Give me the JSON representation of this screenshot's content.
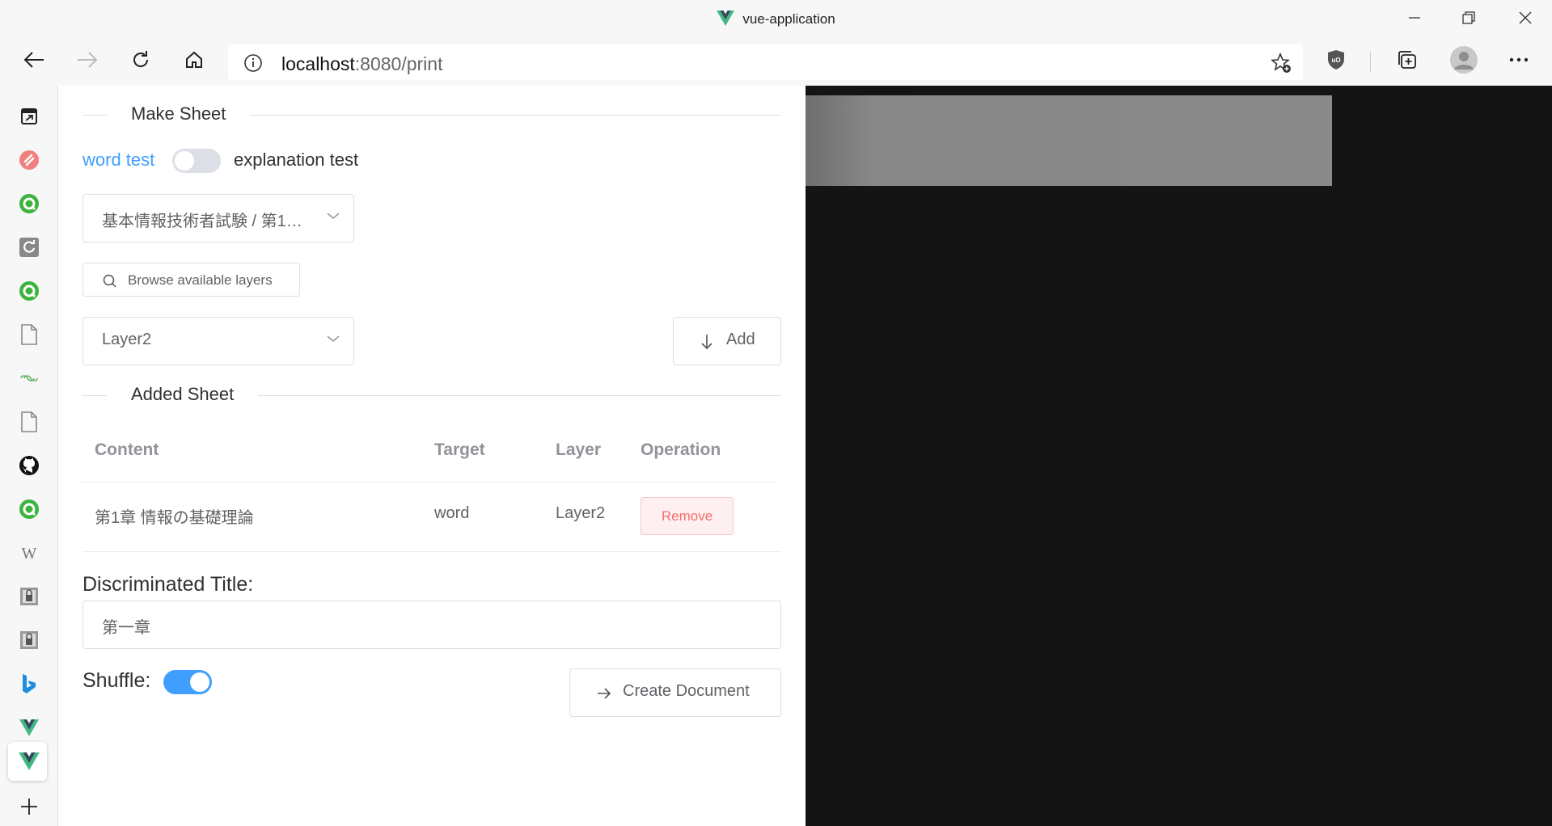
{
  "window": {
    "title": "vue-application"
  },
  "browser": {
    "url_host": "localhost",
    "url_rest": ":8080/print"
  },
  "sidebar": {
    "icons": [
      "tab-actions-icon",
      "scribe-icon",
      "shield-green-icon",
      "refresh-page-icon",
      "shield-green-icon",
      "document-icon",
      "link-icon",
      "document-icon",
      "github-icon",
      "shield-green-icon",
      "wikipedia-icon",
      "lock-page-icon",
      "lock-page-icon",
      "bing-icon",
      "vue-icon",
      "vue-icon"
    ],
    "add_icon": "plus-icon"
  },
  "panel": {
    "make_sheet_title": "Make Sheet",
    "word_test_label": "word test",
    "explanation_test_label": "explanation test",
    "mode_switch_on": false,
    "book_select_value": "基本情報技術者試験 / 第1…",
    "browse_layers_label": "Browse available layers",
    "layer_select_value": "Layer2",
    "add_button_label": "Add",
    "added_sheet_title": "Added Sheet",
    "table": {
      "headers": [
        "Content",
        "Target",
        "Layer",
        "Operation"
      ],
      "rows": [
        {
          "content": "第1章 情報の基礎理論",
          "target": "word",
          "layer": "Layer2",
          "operation": "Remove"
        }
      ]
    },
    "discriminated_title_label": "Discriminated Title:",
    "discriminated_title_value": "第一章",
    "shuffle_label": "Shuffle:",
    "shuffle_on": true,
    "create_document_label": "Create Document"
  },
  "colors": {
    "primary": "#409eff",
    "danger": "#f56c6c",
    "dark_bg": "#141414"
  }
}
